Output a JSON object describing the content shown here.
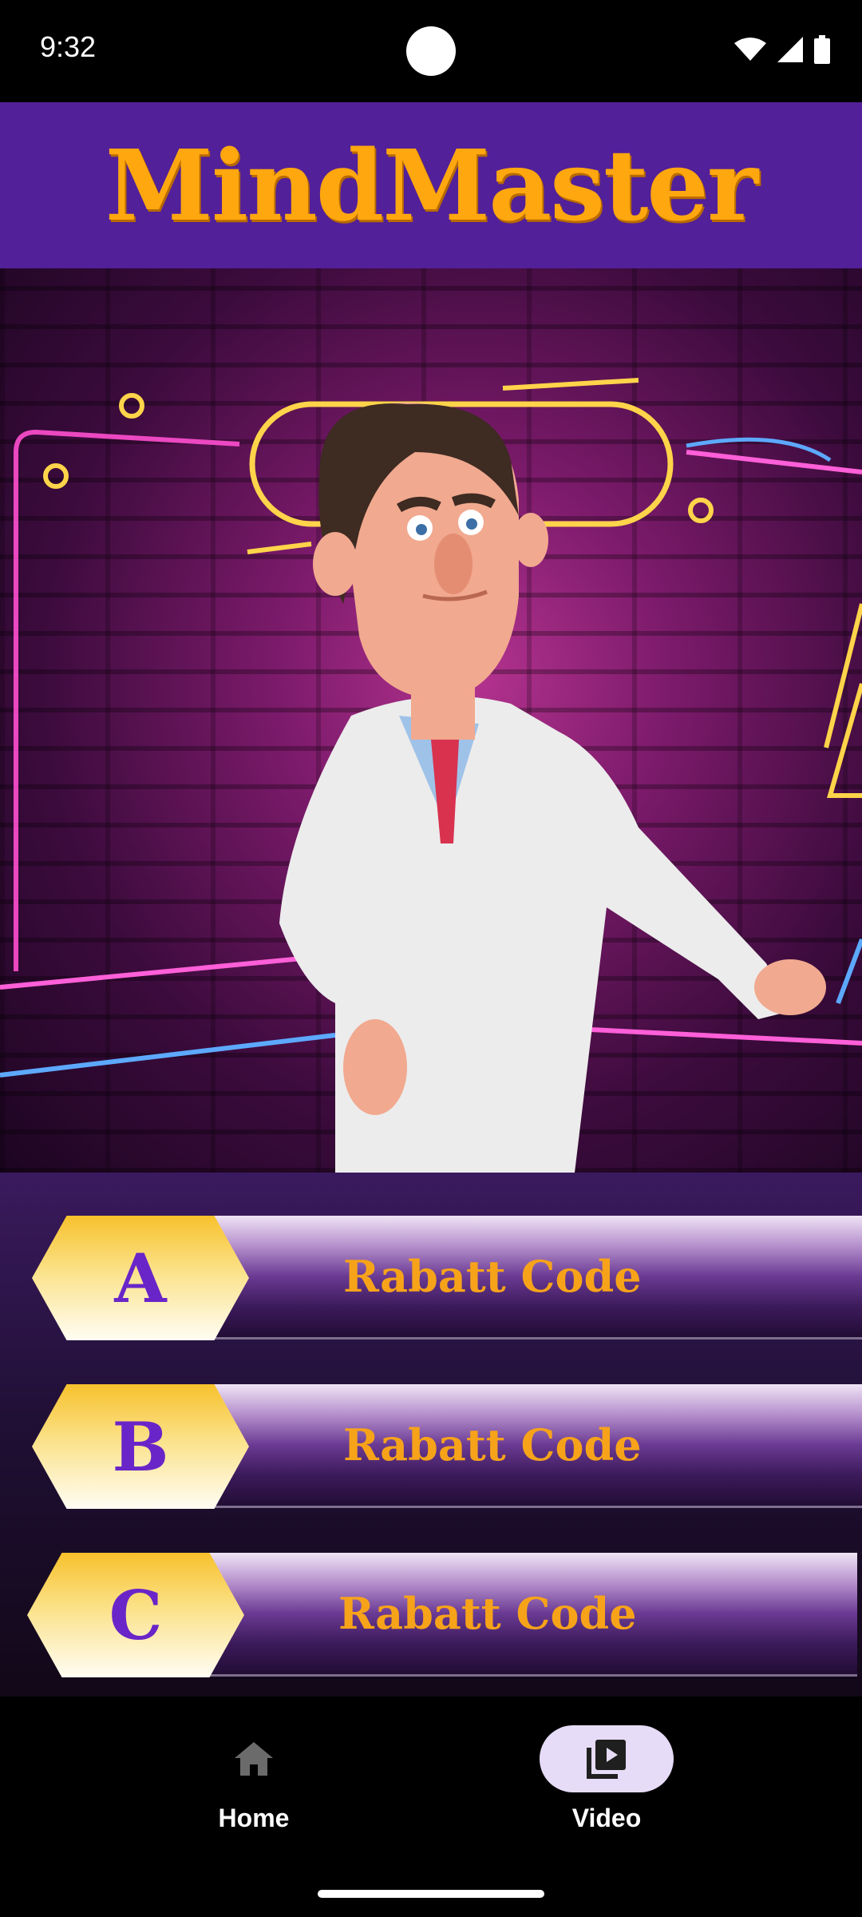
{
  "status": {
    "time": "9:32"
  },
  "app": {
    "title": "MindMaster"
  },
  "options": [
    {
      "letter": "A",
      "label": "Rabatt Code"
    },
    {
      "letter": "B",
      "label": "Rabatt Code"
    },
    {
      "letter": "C",
      "label": "Rabatt Code"
    }
  ],
  "nav": {
    "home_label": "Home",
    "video_label": "Video",
    "selected": "Video"
  },
  "colors": {
    "header_bg": "#522098",
    "title": "#ffa70f",
    "option_label": "#f7a31a",
    "option_letter": "#6a25c8",
    "nav_pill": "#e6dcf7"
  },
  "icons": {
    "home": "home-icon",
    "video": "video-library-icon",
    "wifi": "wifi-icon",
    "signal": "signal-icon",
    "battery": "battery-icon"
  }
}
